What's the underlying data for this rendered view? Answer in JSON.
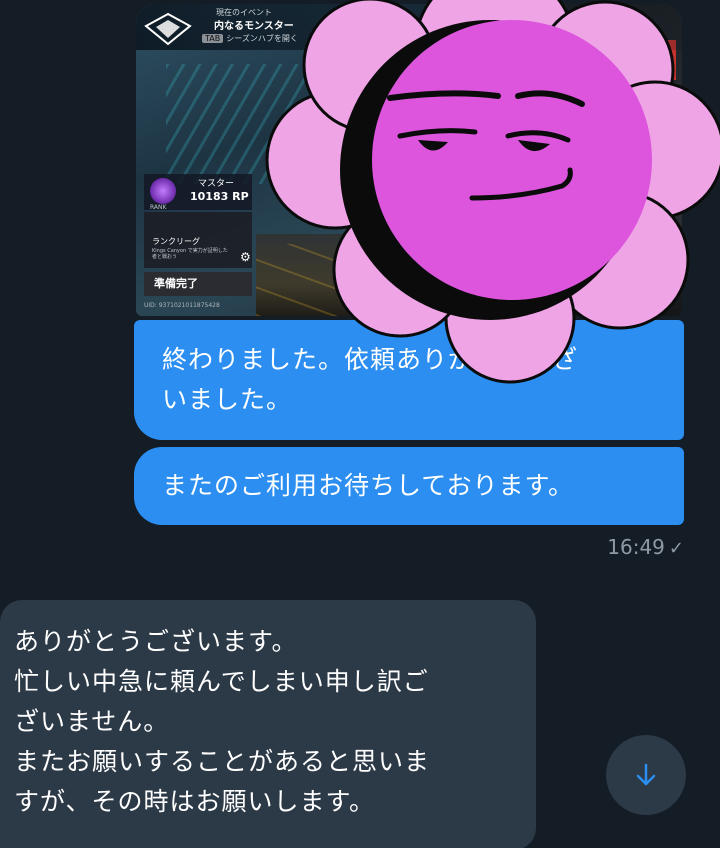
{
  "screenshot": {
    "event_small": "現在のイベント",
    "event_title": "内なるモンスター",
    "season_hub_key": "TAB",
    "season_hub_label": "シーズンハブを開く",
    "rank_name": "マスター",
    "rank_points": "10183 RP",
    "rank_small": "RANK",
    "ranked_title": "ランクリーグ",
    "ranked_sub": "Kings Canyon で実力が証明した者と戦おう",
    "ready_button": "準備完了",
    "uid": "UID: 9371021011875428"
  },
  "sticker": {
    "name": "flower-face-sticker",
    "petal_color": "#efa4e6",
    "face_color": "#dd55dd"
  },
  "messages": {
    "outgoing": [
      {
        "lines": [
          "終わりました。依頼ありがとうござ",
          "いました。"
        ]
      },
      {
        "lines": [
          "またのご利用お待ちしております。"
        ]
      }
    ],
    "outgoing_time": "16:49",
    "incoming": {
      "lines": [
        "ありがとうございます。",
        "忙しい中急に頼んでしまい申し訳ご",
        "ざいません。",
        "またお願いすることがあると思いま",
        "すが、その時はお願いします。"
      ]
    }
  },
  "colors": {
    "background": "#141c26",
    "outgoing_bubble": "#2b8ef0",
    "incoming_bubble": "#2c3947",
    "meta_text": "#8e9aa6",
    "scroll_arrow": "#2b8ef0"
  },
  "icons": {
    "read_check": "check-icon",
    "scroll_down": "arrow-down-icon"
  }
}
